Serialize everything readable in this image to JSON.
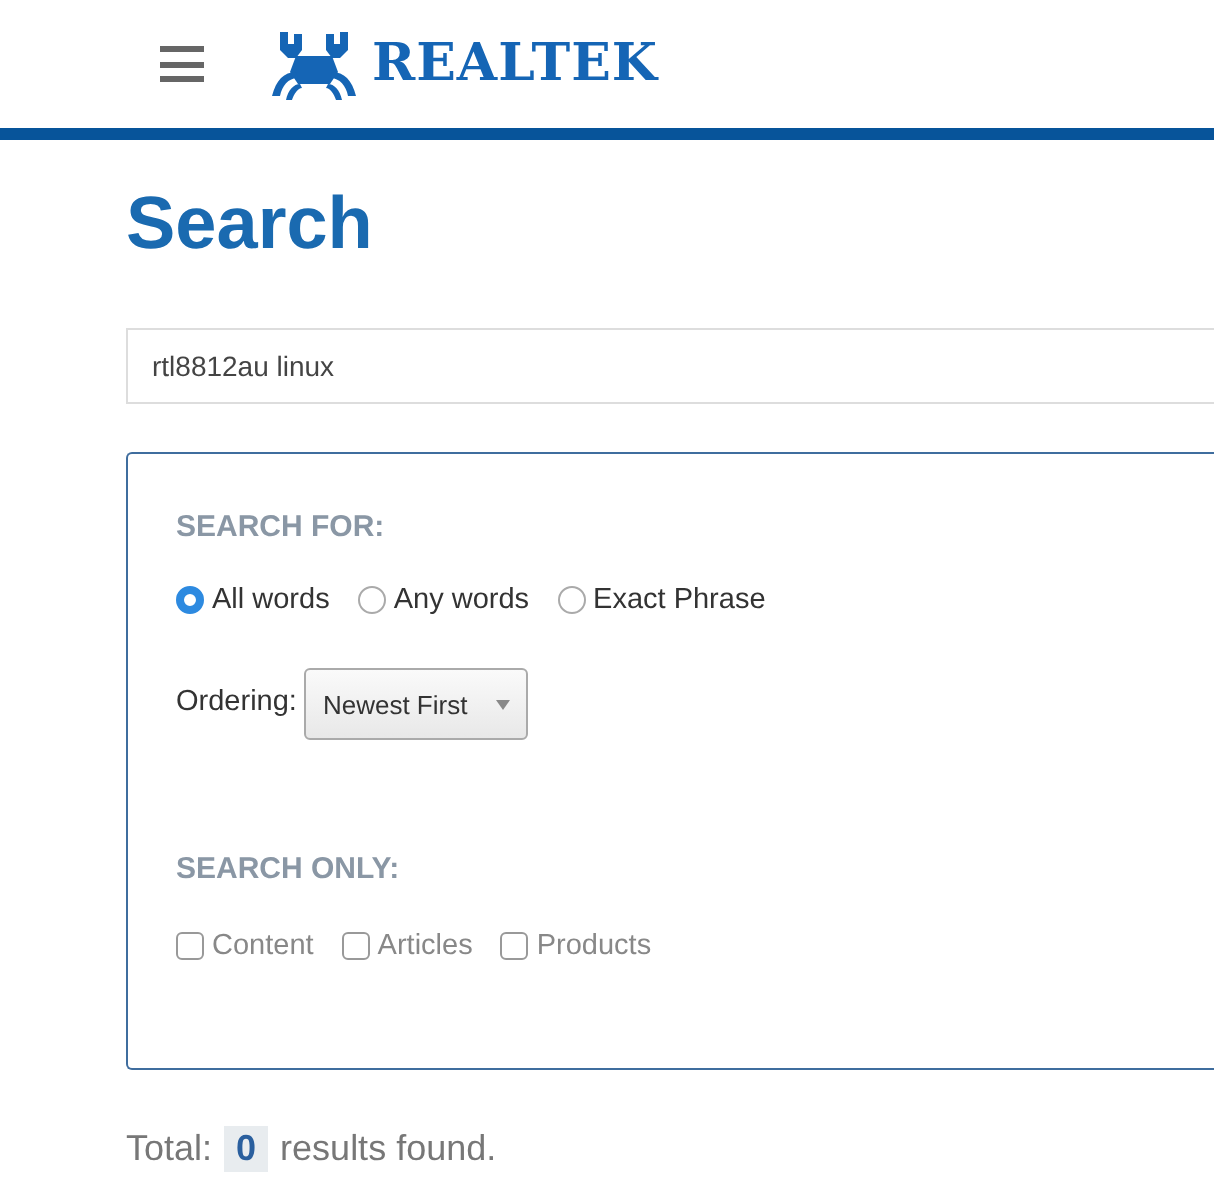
{
  "header": {
    "logo": "REALTEK"
  },
  "title": "Search",
  "search": {
    "value": "rtl8812au linux"
  },
  "search_for": {
    "heading": "SEARCH FOR:",
    "options": [
      {
        "label": "All words",
        "selected": true
      },
      {
        "label": "Any words",
        "selected": false
      },
      {
        "label": "Exact Phrase",
        "selected": false
      }
    ]
  },
  "ordering": {
    "label": "Ordering:",
    "value": "Newest First"
  },
  "search_only": {
    "heading": "SEARCH ONLY:",
    "options": [
      {
        "label": "Content",
        "checked": false
      },
      {
        "label": "Articles",
        "checked": false
      },
      {
        "label": "Products",
        "checked": false
      }
    ]
  },
  "results": {
    "prefix": "Total:",
    "count": "0",
    "suffix": "results found."
  }
}
